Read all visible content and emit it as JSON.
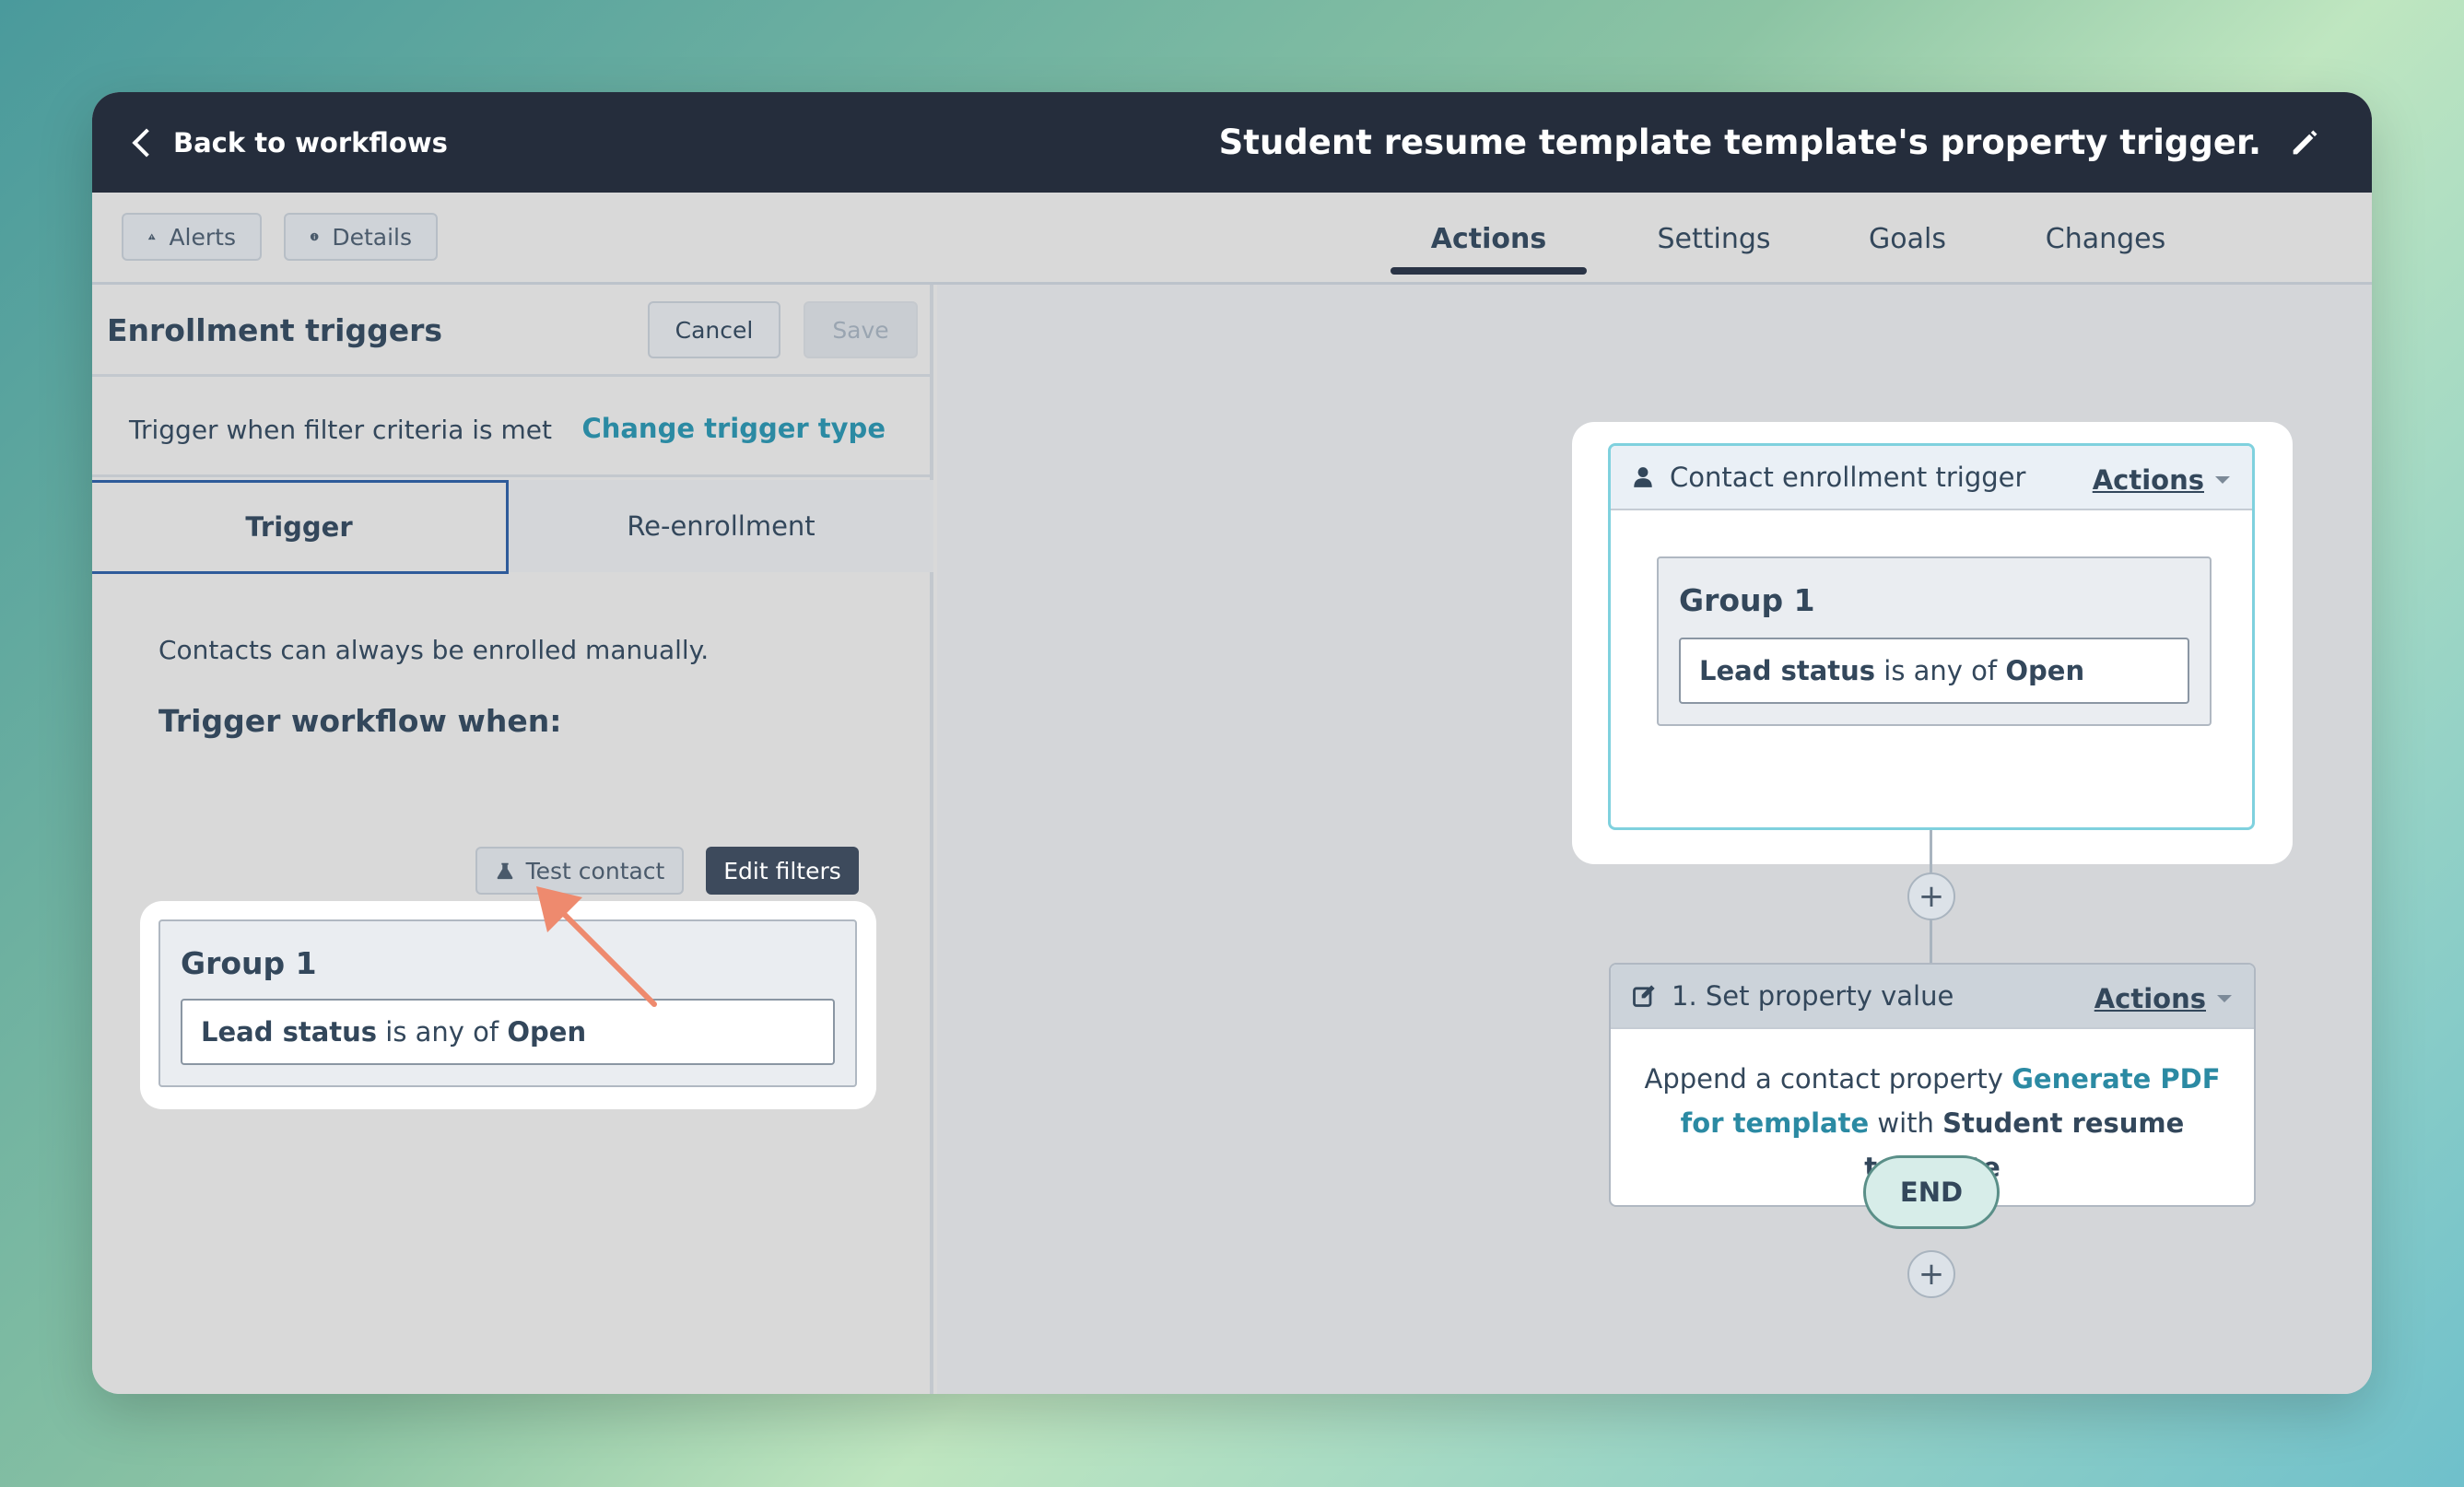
{
  "header": {
    "back_label": "Back to workflows",
    "workflow_title": "Student resume template template's property trigger."
  },
  "subbar": {
    "alerts_label": "Alerts",
    "details_label": "Details",
    "tabs": [
      {
        "label": "Actions",
        "active": true
      },
      {
        "label": "Settings",
        "active": false
      },
      {
        "label": "Goals",
        "active": false
      },
      {
        "label": "Changes",
        "active": false
      }
    ]
  },
  "left_panel": {
    "title": "Enrollment triggers",
    "cancel_label": "Cancel",
    "save_label": "Save",
    "trigger_text": "Trigger when filter criteria is met",
    "change_trigger_label": "Change trigger type",
    "subtabs": [
      {
        "label": "Trigger",
        "active": true
      },
      {
        "label": "Re-enrollment",
        "active": false
      }
    ],
    "manual_text": "Contacts can always be enrolled manually.",
    "trigger_when_label": "Trigger workflow when:",
    "test_contact_label": "Test contact",
    "edit_filters_label": "Edit filters",
    "group": {
      "label": "Group 1",
      "filter_property": "Lead status",
      "filter_operator": " is any of ",
      "filter_value": "Open"
    }
  },
  "canvas": {
    "trigger_node": {
      "title": "Contact enrollment trigger",
      "actions_label": "Actions",
      "group_label": "Group 1",
      "filter_property": "Lead status",
      "filter_operator": " is any of ",
      "filter_value": "Open"
    },
    "action_node": {
      "title": "1. Set property value",
      "actions_label": "Actions",
      "body_prefix": "Append a contact property ",
      "body_link_1": "Generate PDF",
      "body_link_2": "for template",
      "body_mid": " with ",
      "body_value": "Student resume template"
    },
    "plus_label": "+",
    "end_label": "END"
  },
  "colors": {
    "topbar": "#252d3c",
    "link": "#2b8aa3",
    "selected_border": "#7fd1de",
    "arrow": "#ee8a6e"
  }
}
